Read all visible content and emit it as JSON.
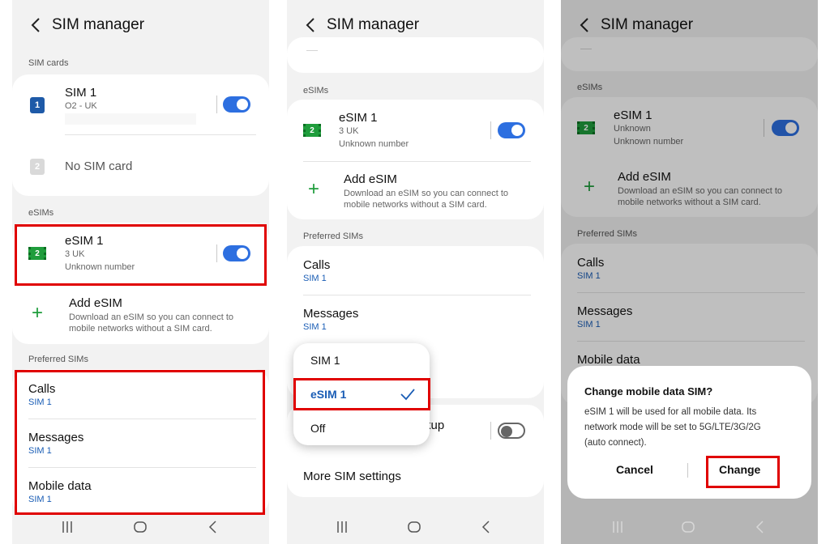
{
  "colors": {
    "accent": "#2d6fe0",
    "highlight": "#e00000",
    "esim_green": "#1f9d3c",
    "link_blue": "#1a5db5"
  },
  "screen1": {
    "title": "SIM manager",
    "sim_cards_section": "SIM cards",
    "sim1": {
      "name": "SIM 1",
      "carrier": "O2 - UK",
      "badge": "1",
      "toggle_on": true
    },
    "sim2": {
      "name": "No SIM card",
      "badge": "2"
    },
    "esims_section": "eSIMs",
    "esim1": {
      "name": "eSIM 1",
      "carrier": "3 UK",
      "number": "Unknown number",
      "badge": "2",
      "toggle_on": true
    },
    "add_esim": {
      "title": "Add eSIM",
      "desc_line1": "Download an eSIM so you can connect to",
      "desc_line2": "mobile networks without a SIM card."
    },
    "preferred_section": "Preferred SIMs",
    "calls": {
      "label": "Calls",
      "value": "SIM 1"
    },
    "messages": {
      "label": "Messages",
      "value": "SIM 1"
    },
    "mobile_data": {
      "label": "Mobile data",
      "value": "SIM 1"
    }
  },
  "screen2": {
    "title": "SIM manager",
    "esims_section": "eSIMs",
    "esim1": {
      "name": "eSIM 1",
      "carrier": "3 UK",
      "number": "Unknown number",
      "badge": "2",
      "toggle_on": true
    },
    "add_esim": {
      "title": "Add eSIM",
      "desc_line1": "Download an eSIM so you can connect to",
      "desc_line2": "mobile networks without a SIM card."
    },
    "preferred_section": "Preferred SIMs",
    "calls": {
      "label": "Calls",
      "value": "SIM 1"
    },
    "messages": {
      "label": "Messages",
      "value": "SIM 1"
    },
    "backup_partial": "kup",
    "more_settings": "More SIM settings",
    "dropdown": {
      "options": [
        "SIM 1",
        "eSIM 1",
        "Off"
      ],
      "selected": "eSIM 1",
      "check_icon": "checkmark-icon"
    }
  },
  "screen3": {
    "title": "SIM manager",
    "esims_section": "eSIMs",
    "esim1": {
      "name": "eSIM 1",
      "carrier": "Unknown",
      "number": "Unknown number",
      "badge": "2",
      "toggle_on": true
    },
    "add_esim": {
      "title": "Add eSIM",
      "desc_line1": "Download an eSIM so you can connect to",
      "desc_line2": "mobile networks without a SIM card."
    },
    "preferred_section": "Preferred SIMs",
    "calls": {
      "label": "Calls",
      "value": "SIM 1"
    },
    "messages": {
      "label": "Messages",
      "value": "SIM 1"
    },
    "mobile_data": {
      "label": "Mobile data"
    },
    "dialog": {
      "title": "Change mobile data SIM?",
      "body_line1": "eSIM 1 will be used for all mobile data. Its",
      "body_line2": "network mode will be set to 5G/LTE/3G/2G",
      "body_line3": "(auto connect).",
      "cancel": "Cancel",
      "change": "Change"
    }
  },
  "nav_icons": [
    "recent-apps-icon",
    "home-icon",
    "back-icon"
  ]
}
